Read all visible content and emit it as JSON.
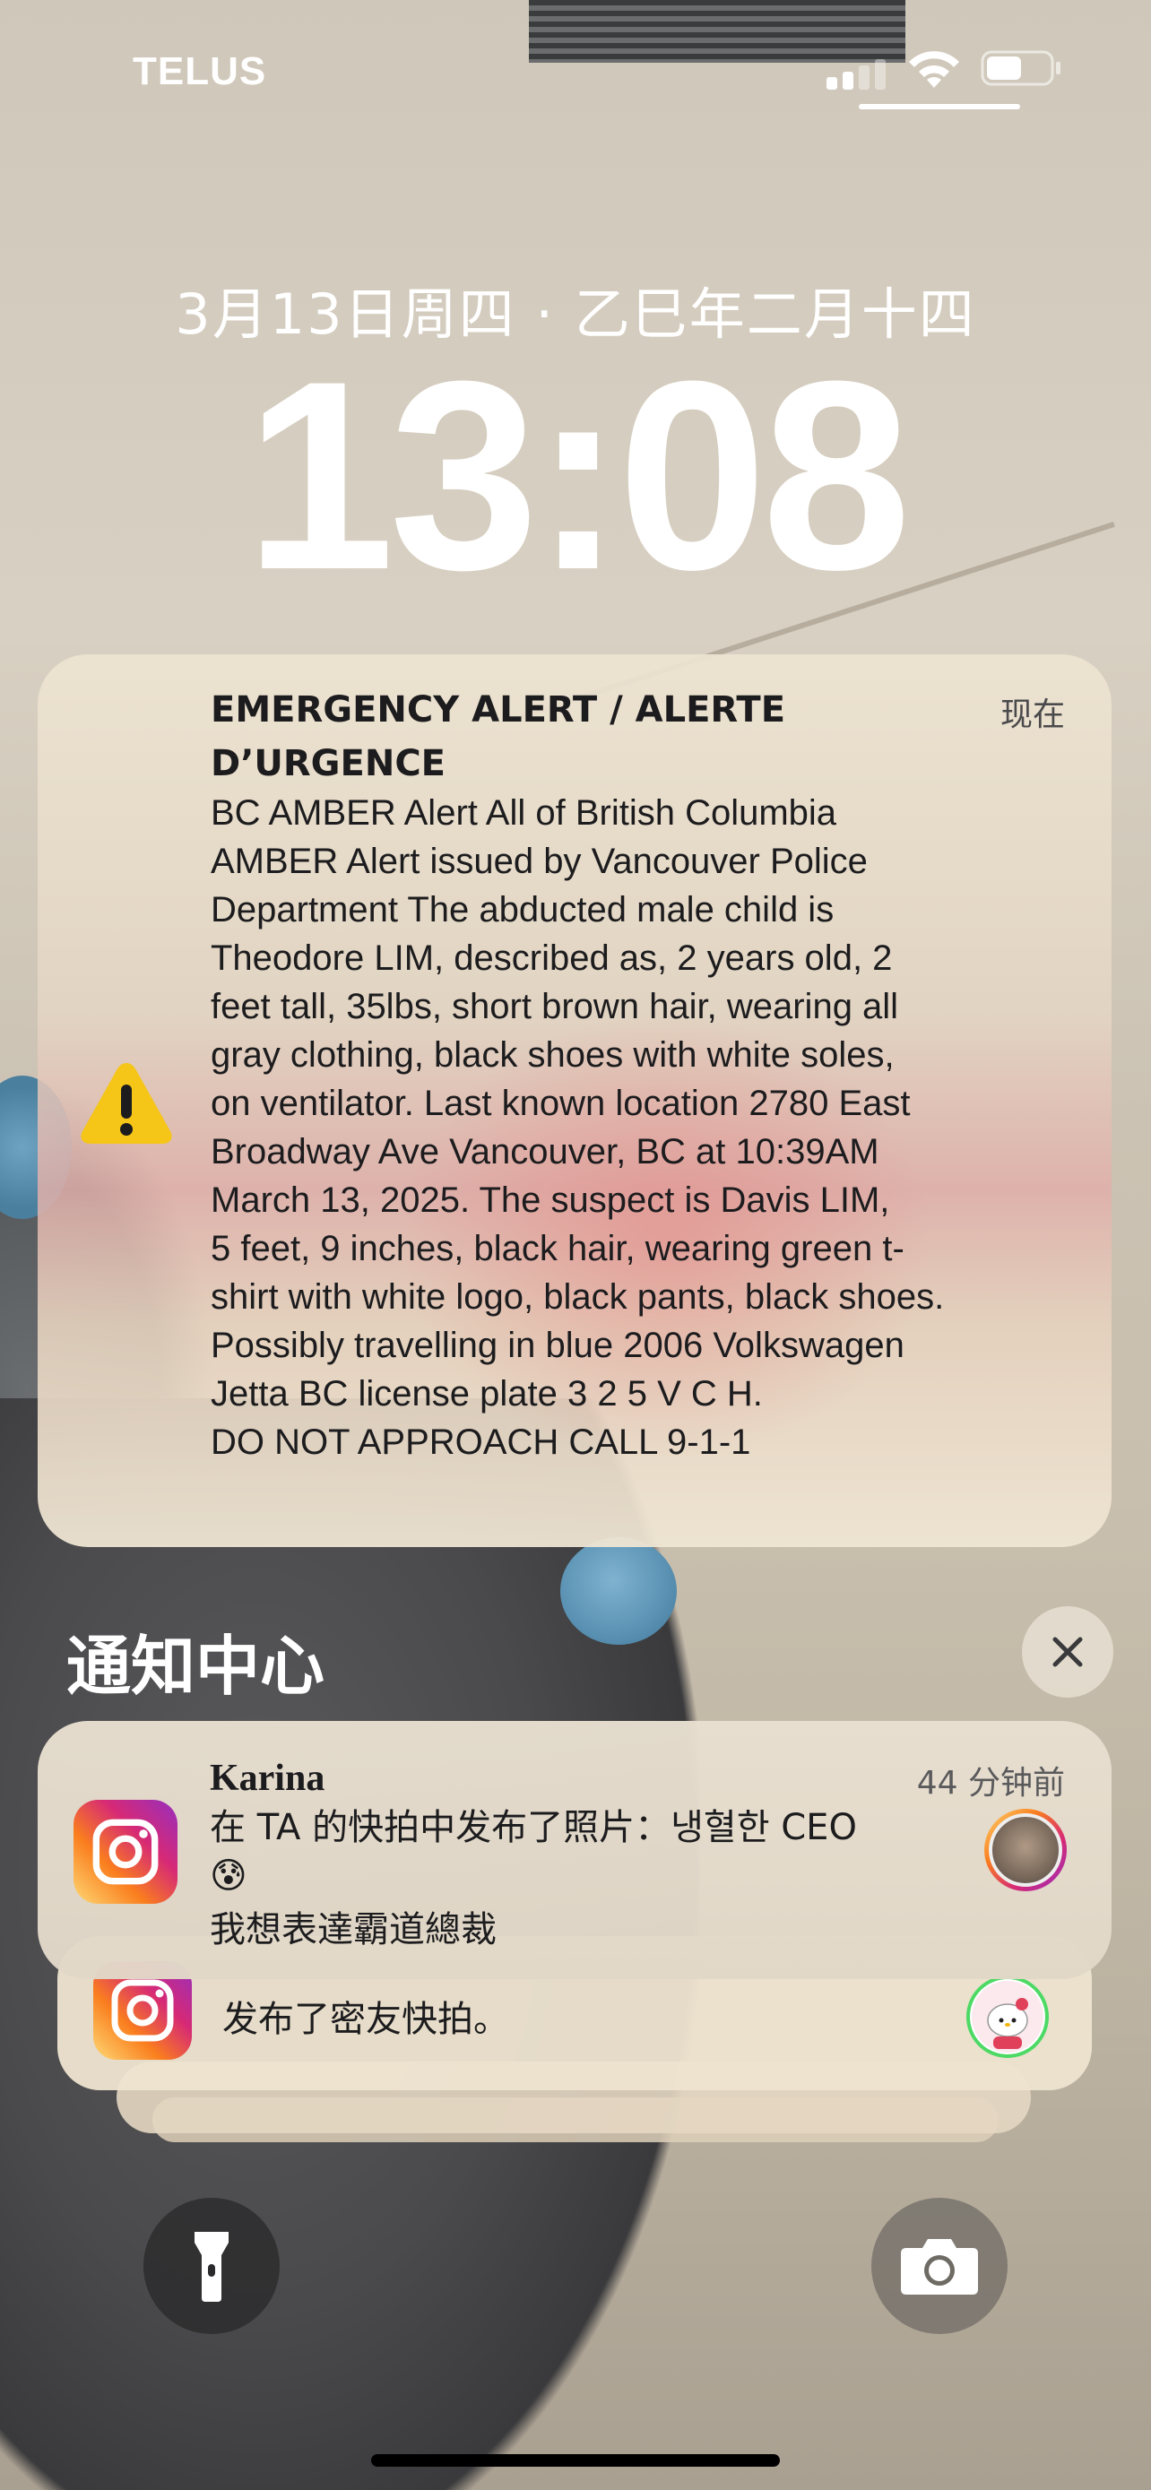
{
  "status_bar": {
    "carrier": "TELUS"
  },
  "lock_screen": {
    "date": "3月13日周四 · 乙巳年二月十四",
    "time": "13:08"
  },
  "alert": {
    "title": "EMERGENCY ALERT / ALERTE D’URGENCE",
    "time": "现在",
    "body": "BC AMBER Alert All of British Columbia\nAMBER Alert issued by Vancouver Police\nDepartment The abducted male child is\nTheodore LIM, described as, 2 years old, 2\nfeet tall, 35lbs, short brown hair, wearing all\ngray clothing, black shoes with white soles,\non ventilator.  Last known location 2780 East\nBroadway Ave Vancouver, BC at 10:39AM\nMarch 13, 2025.  The suspect is Davis LIM,\n5 feet, 9 inches, black hair, wearing green t-\nshirt with white logo, black pants, black shoes.\nPossibly travelling in blue 2006 Volkswagen\nJetta BC license plate 3 2 5 V C H.\nDO NOT APPROACH CALL 9-1-1",
    "icon": "warning-icon",
    "icon_color": "#f5c518"
  },
  "notification_center": {
    "title": "通知中心",
    "notifications": [
      {
        "app": "instagram",
        "sender": "Karina",
        "time": "44 分钟前",
        "message_line1": "在 TA 的快拍中发布了照片：냉혈한 CEO😰",
        "message_line2": "我想表達霸道總裁"
      },
      {
        "app": "instagram",
        "message": "发布了密友快拍。"
      }
    ]
  },
  "controls": {
    "flashlight_icon": "flashlight-icon",
    "camera_icon": "camera-icon"
  }
}
